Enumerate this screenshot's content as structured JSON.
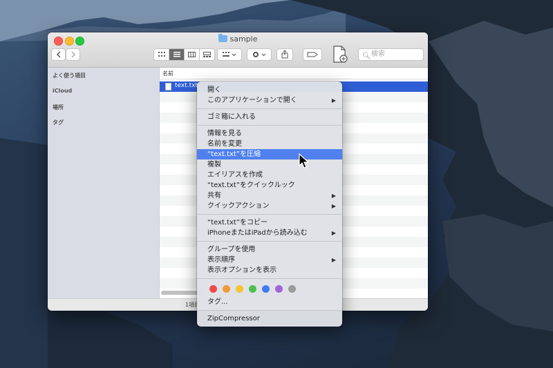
{
  "window": {
    "title": "sample",
    "search_placeholder": "検索"
  },
  "sidebar": {
    "items": [
      {
        "label": "よく使う項目"
      },
      {
        "label": "iCloud"
      },
      {
        "label": "場所"
      },
      {
        "label": "タグ"
      }
    ]
  },
  "file_list": {
    "column_header": "名前",
    "selected_file": "text.txt"
  },
  "status_bar": {
    "text": "1項目"
  },
  "context_menu": {
    "items": [
      {
        "label": "開く"
      },
      {
        "label": "このアプリケーションで開く",
        "submenu": true
      },
      {
        "label": "ゴミ箱に入れる"
      },
      {
        "label": "情報を見る"
      },
      {
        "label": "名前を変更"
      },
      {
        "label": "“text.txt”を圧縮",
        "highlighted": true
      },
      {
        "label": "複製"
      },
      {
        "label": "エイリアスを作成"
      },
      {
        "label": "“text.txt”をクイックルック"
      },
      {
        "label": "共有",
        "submenu": true
      },
      {
        "label": "クイックアクション",
        "submenu": true
      },
      {
        "label": "“text.txt”をコピー"
      },
      {
        "label": "iPhoneまたはiPadから読み込む",
        "submenu": true
      },
      {
        "label": "グループを使用"
      },
      {
        "label": "表示順序",
        "submenu": true
      },
      {
        "label": "表示オプションを表示"
      },
      {
        "label": "タグ..."
      },
      {
        "label": "ZipCompressor"
      }
    ],
    "tag_colors": [
      "#ef4b4b",
      "#f29a38",
      "#f5c431",
      "#4cc04f",
      "#3f7cf2",
      "#a264d8",
      "#9a9a9d"
    ],
    "submenu_arrow": "▶"
  },
  "colors": {
    "selection": "#2f5fd6",
    "menu_highlight": "#4f80ee"
  }
}
